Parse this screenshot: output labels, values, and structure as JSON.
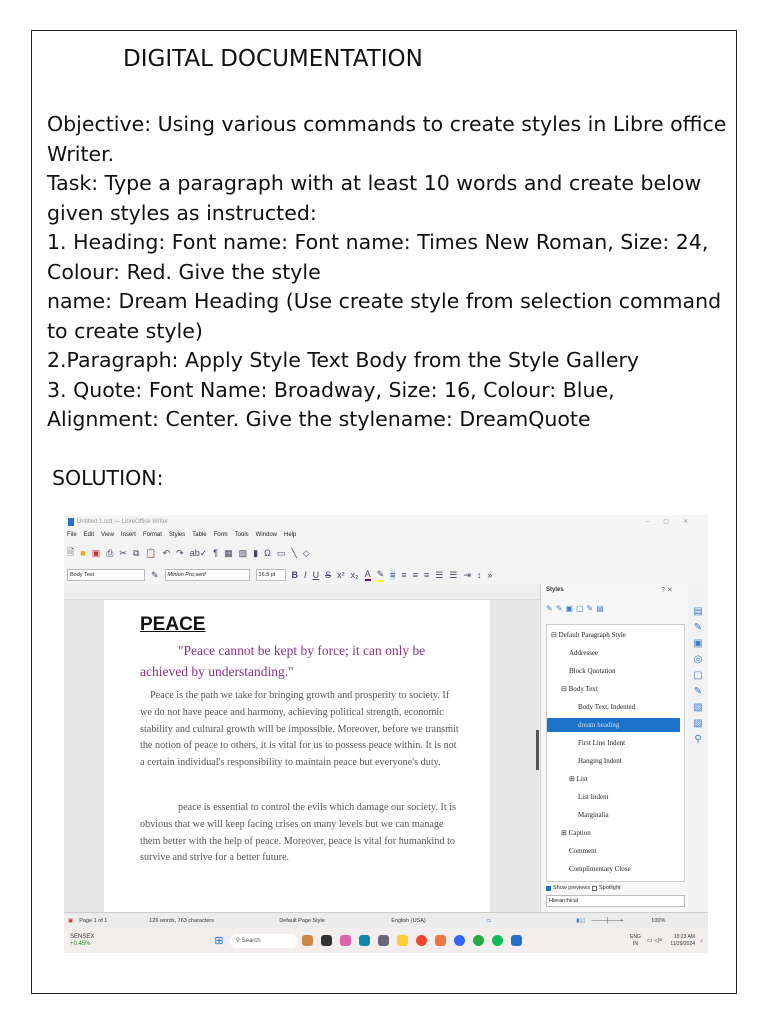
{
  "document": {
    "title": "DIGITAL DOCUMENTATION",
    "paragraphs": [
      "Objective: Using various commands to create styles in Libre office Writer.",
      "Task: Type a paragraph with at least 10 words and create below given styles as instructed:",
      "1. Heading: Font name: Font name: Times New Roman, Size: 24, Colour: Red. Give the style",
      "name: Dream Heading (Use create style from selection command to create style)",
      "2.Paragraph: Apply Style Text Body from the Style Gallery",
      "3. Quote: Font Name: Broadway, Size: 16, Colour: Blue, Alignment: Center. Give the stylename: DreamQuote"
    ],
    "solution_label": "SOLUTION:"
  },
  "screenshot": {
    "window_title": "Untitled 1.odt — LibreOffice Writer",
    "menu": [
      "File",
      "Edit",
      "View",
      "Insert",
      "Format",
      "Styles",
      "Table",
      "Form",
      "Tools",
      "Window",
      "Help"
    ],
    "paragraph_style": "Body Text",
    "font_name": "Minion Pro;serif",
    "font_size": "16.5 pt",
    "doc": {
      "heading": "PEACE",
      "quote": "\"Peace cannot be kept by force; it can only be achieved by understanding.\"",
      "para1": "Peace is the path we take for bringing growth and prosperity to society. If we do not have peace and harmony, achieving political strength, economic stability and cultural growth will be impossible. Moreover, before we transmit the notion of peace to others, it is vital for us to possess peace within. It is not a certain individual's responsibility to maintain peace but everyone's duty.",
      "para2": "peace is essential to control the evils which damage our society. It is obvious that we will keep facing crises on many levels but we can manage them better with the help of peace. Moreover, peace is vital for humankind to survive and strive for a better future."
    },
    "sidebar": {
      "title": "Styles",
      "styles": [
        "Default Paragraph Style",
        "Addressee",
        "Block Quotation",
        "Body Text",
        "Body Text, Indented",
        "dream heading",
        "First Line Indent",
        "Hanging Indent",
        "List",
        "List Indent",
        "Marginalia",
        "Caption",
        "Comment",
        "Complimentary Close"
      ],
      "selected": "dream heading",
      "show_previews": "Show previews",
      "spotlight": "Spotlight",
      "filter": "Hierarchical"
    },
    "status": {
      "page": "Page 1 of 1",
      "words": "126 words, 763 characters",
      "page_style": "Default Page Style",
      "language": "English (USA)",
      "zoom": "100%"
    },
    "taskbar": {
      "ticker": "SENSEX",
      "ticker_change": "+0.45%",
      "search": "Search",
      "lang": "ENG",
      "region": "IN",
      "time": "10:23 AM",
      "date": "11/29/2024"
    }
  }
}
